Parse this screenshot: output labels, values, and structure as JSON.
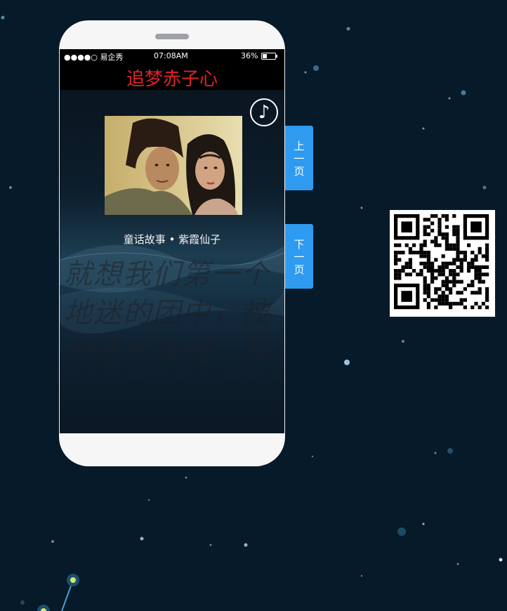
{
  "status_bar": {
    "carrier": "●●●●○ 易企秀",
    "time": "07:08AM",
    "battery_percent": "36%",
    "battery_level": 0.36
  },
  "page": {
    "title": "追梦赤子心",
    "caption": "童话故事 • 紫霞仙子",
    "background_text_lines": [
      "就想我们第一个",
      "地迷的团中，被",
      "他送的玫瑰，早"
    ]
  },
  "controls": {
    "music_icon": "♪",
    "prev_button_chars": [
      "上",
      "一",
      "页"
    ],
    "next_button_chars": [
      "下",
      "一",
      "页"
    ]
  },
  "icons": {
    "music": "music-note-icon",
    "qr": "qr-code-icon"
  },
  "colors": {
    "background": "#061a2a",
    "title": "#e0222a",
    "nav_button": "#2e9bf0"
  }
}
